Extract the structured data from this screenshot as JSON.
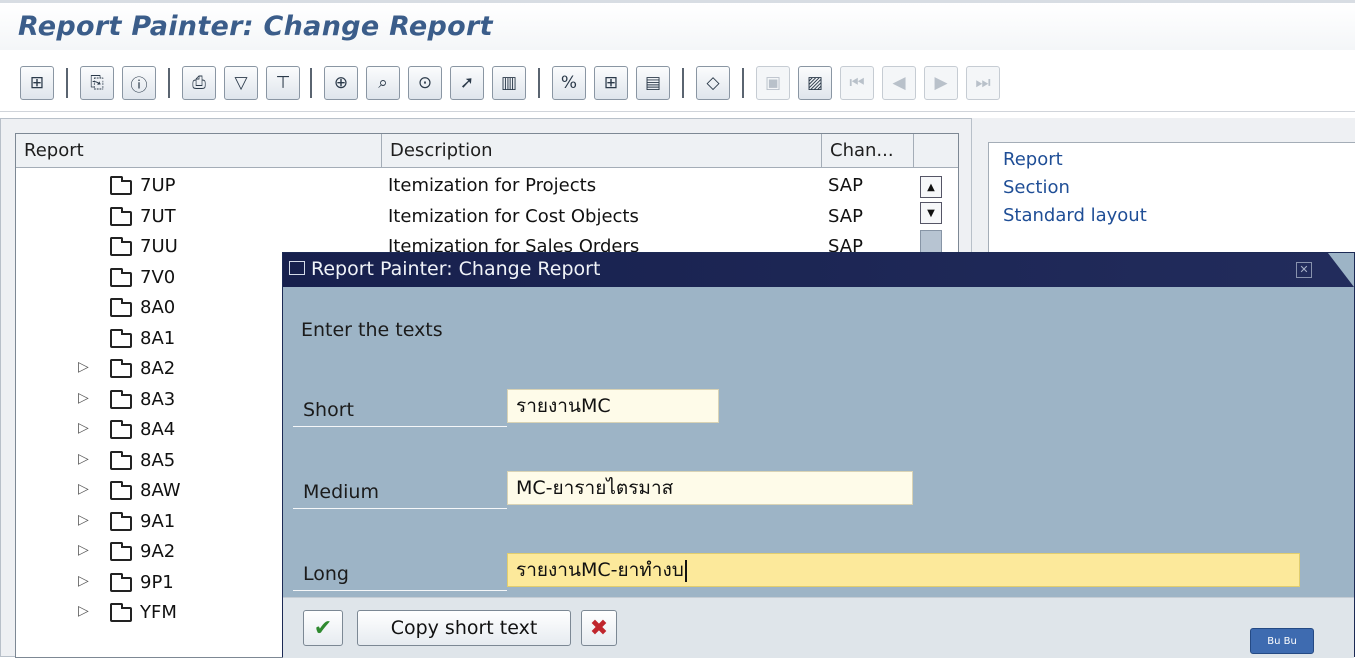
{
  "window": {
    "title": "Report Painter: Change Report"
  },
  "toolbar": {
    "icons": [
      "hierarchy-icon",
      "new-report-icon",
      "info-icon",
      "print-icon",
      "filter-icon",
      "structure-icon",
      "insert-row-icon",
      "search-icon",
      "execute-icon",
      "select-icon",
      "delete-icon",
      "formula-icon",
      "add-element-icon",
      "edit-element-icon",
      "variable-icon",
      "first-page-icon",
      "export-icon",
      "first-icon",
      "previous-icon",
      "next-icon",
      "last-icon"
    ]
  },
  "tree": {
    "columns": [
      "Report",
      "Description",
      "Chan..."
    ],
    "rows": [
      {
        "code": "7UP",
        "description": "Itemization for Projects",
        "change": "SAP",
        "expandable": false
      },
      {
        "code": "7UT",
        "description": "Itemization for Cost Objects",
        "change": "SAP",
        "expandable": false
      },
      {
        "code": "7UU",
        "description": "Itemization for Sales Orders",
        "change": "SAP",
        "expandable": false
      },
      {
        "code": "7V0",
        "description": "",
        "change": "",
        "expandable": false
      },
      {
        "code": "8A0",
        "description": "",
        "change": "",
        "expandable": false
      },
      {
        "code": "8A1",
        "description": "",
        "change": "",
        "expandable": false
      },
      {
        "code": "8A2",
        "description": "",
        "change": "",
        "expandable": true
      },
      {
        "code": "8A3",
        "description": "",
        "change": "",
        "expandable": true
      },
      {
        "code": "8A4",
        "description": "",
        "change": "",
        "expandable": true
      },
      {
        "code": "8A5",
        "description": "",
        "change": "",
        "expandable": true
      },
      {
        "code": "8AW",
        "description": "",
        "change": "",
        "expandable": true
      },
      {
        "code": "9A1",
        "description": "",
        "change": "",
        "expandable": true
      },
      {
        "code": "9A2",
        "description": "",
        "change": "",
        "expandable": true
      },
      {
        "code": "9P1",
        "description": "",
        "change": "",
        "expandable": true
      },
      {
        "code": "YFM",
        "description": "",
        "change": "",
        "expandable": true
      }
    ]
  },
  "right_panel": {
    "links": [
      "Report",
      "Section",
      "Standard layout"
    ]
  },
  "dialog": {
    "title": "Report Painter: Change Report",
    "prompt": "Enter the texts",
    "fields": {
      "short": {
        "label": "Short",
        "value": "รายงานMC"
      },
      "medium": {
        "label": "Medium",
        "value": "MC-ยารายไตรมาส"
      },
      "long": {
        "label": "Long",
        "value": "รายงานMC-ยาทำงบ"
      }
    },
    "buttons": {
      "confirm_icon": "checkmark-icon",
      "copy_label": "Copy short text",
      "cancel_icon": "cancel-icon"
    }
  },
  "badge": {
    "label": "Bu Bu"
  },
  "colors": {
    "title": "#3b5d8a",
    "dialog_bg": "#9db4c6",
    "dialog_title": "#17204d",
    "active_field": "#fce99b"
  }
}
